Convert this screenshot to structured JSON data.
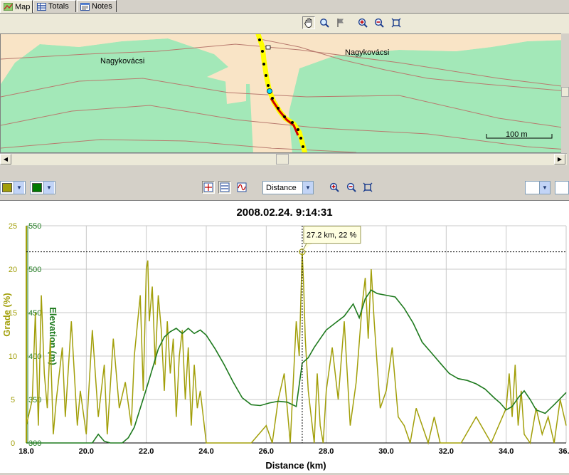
{
  "tabs": [
    {
      "label": "Map",
      "active": true
    },
    {
      "label": "Totals",
      "active": false
    },
    {
      "label": "Notes",
      "active": false
    }
  ],
  "map": {
    "places": [
      {
        "label": "Nagykovácsi",
        "sx": 140,
        "sy": 42
      },
      {
        "label": "Nagykovácsi",
        "sx": 484,
        "sy": 32
      }
    ],
    "scale_label": "100 m",
    "colors": {
      "forest": "#a3e8b8",
      "open": "#f9e4c6",
      "contour": "#b87a6e",
      "track": "#ffff00",
      "track_dots": "#000000",
      "track_red": "#cc0000"
    }
  },
  "chart_toolbar": {
    "color1": "#a29f0a",
    "color2": "#007a00",
    "x_axis_select": "Distance"
  },
  "chart_data": {
    "type": "line",
    "title": "2008.02.24. 9:14:31",
    "xlabel": "Distance (km)",
    "ylabel_left": "Grade (%)",
    "ylabel_right": "Elevation (m)",
    "xlim": [
      18.0,
      36.0
    ],
    "x_ticks": [
      "18.0",
      "20.0",
      "22.0",
      "24.0",
      "26.0",
      "28.0",
      "30.0",
      "32.0",
      "34.0",
      "36.0"
    ],
    "grade_ticks": [
      "0",
      "5",
      "10",
      "15",
      "20",
      "25"
    ],
    "elev_ticks": [
      "300",
      "350",
      "400",
      "450",
      "500",
      "550"
    ],
    "grade_lim": [
      0,
      25
    ],
    "elev_lim": [
      300,
      550
    ],
    "cursor": {
      "x": 27.2,
      "grade": 22,
      "label": "27.2 km, 22 %"
    },
    "grid": true,
    "series": [
      {
        "name": "Elevation (m)",
        "color": "#1e7a1e",
        "x": [
          18.0,
          18.4,
          18.8,
          19.2,
          19.6,
          20.0,
          20.2,
          20.4,
          20.6,
          20.8,
          21.0,
          21.2,
          21.4,
          21.6,
          21.8,
          22.0,
          22.2,
          22.4,
          22.6,
          22.8,
          23.0,
          23.2,
          23.4,
          23.6,
          23.8,
          24.0,
          24.3,
          24.6,
          24.9,
          25.2,
          25.5,
          25.8,
          26.1,
          26.4,
          26.7,
          27.0,
          27.2,
          27.4,
          27.6,
          27.8,
          28.0,
          28.3,
          28.6,
          28.9,
          29.1,
          29.3,
          29.5,
          29.7,
          30.0,
          30.3,
          30.6,
          30.9,
          31.2,
          31.5,
          31.8,
          32.1,
          32.4,
          32.7,
          33.0,
          33.3,
          33.6,
          33.8,
          34.0,
          34.2,
          34.4,
          34.6,
          34.8,
          35.0,
          35.3,
          35.6,
          36.0
        ],
        "values": [
          300,
          300,
          300,
          300,
          300,
          300,
          300,
          310,
          302,
          300,
          300,
          300,
          306,
          318,
          340,
          362,
          385,
          408,
          422,
          428,
          432,
          426,
          432,
          426,
          430,
          424,
          408,
          390,
          370,
          352,
          344,
          343,
          346,
          348,
          347,
          342,
          392,
          398,
          410,
          420,
          430,
          438,
          446,
          460,
          444,
          466,
          476,
          472,
          470,
          468,
          455,
          438,
          416,
          404,
          392,
          380,
          374,
          372,
          368,
          362,
          352,
          346,
          338,
          342,
          352,
          360,
          350,
          338,
          334,
          344,
          358
        ]
      },
      {
        "name": "Grade (%)",
        "color": "#a29f0a",
        "x": [
          18.0,
          18.2,
          18.3,
          18.4,
          18.5,
          18.6,
          18.7,
          18.8,
          18.9,
          19.0,
          19.2,
          19.3,
          19.5,
          19.7,
          19.8,
          20.0,
          20.2,
          20.4,
          20.6,
          20.7,
          20.9,
          21.1,
          21.3,
          21.5,
          21.6,
          21.8,
          21.9,
          22.0,
          22.05,
          22.1,
          22.2,
          22.3,
          22.4,
          22.5,
          22.6,
          22.7,
          22.8,
          22.9,
          23.0,
          23.1,
          23.2,
          23.3,
          23.4,
          23.5,
          23.6,
          23.7,
          23.8,
          23.9,
          24.0,
          24.5,
          25.0,
          25.5,
          26.0,
          26.2,
          26.4,
          26.6,
          26.8,
          27.0,
          27.1,
          27.2,
          27.25,
          27.3,
          27.4,
          27.5,
          27.6,
          27.7,
          27.8,
          27.9,
          28.0,
          28.2,
          28.4,
          28.6,
          28.8,
          29.0,
          29.2,
          29.3,
          29.4,
          29.5,
          29.6,
          29.7,
          29.8,
          30.0,
          30.2,
          30.4,
          30.6,
          30.8,
          31.0,
          31.2,
          31.4,
          31.6,
          31.8,
          32.0,
          32.5,
          33.0,
          33.5,
          34.0,
          34.1,
          34.2,
          34.3,
          34.4,
          34.5,
          34.6,
          34.8,
          35.0,
          35.2,
          35.4,
          35.6,
          35.8,
          36.0
        ],
        "values": [
          2,
          5,
          15,
          2,
          17,
          8,
          4,
          12,
          1,
          5,
          11,
          3,
          14,
          2,
          6,
          1,
          13,
          3,
          9,
          1,
          12,
          4,
          7,
          2,
          10,
          17,
          6,
          20,
          21,
          14,
          18,
          9,
          17,
          13,
          6,
          14,
          8,
          12,
          3,
          10,
          13,
          5,
          11,
          2,
          9,
          4,
          6,
          3,
          0,
          0,
          0,
          0,
          2,
          0,
          5,
          8,
          0,
          14,
          10,
          22,
          18,
          12,
          6,
          3,
          0,
          8,
          2,
          0,
          6,
          11,
          5,
          14,
          2,
          7,
          16,
          19,
          12,
          20,
          14,
          9,
          4,
          6,
          11,
          3,
          2,
          0,
          4,
          2,
          0,
          3,
          0,
          0,
          0,
          3,
          0,
          4,
          8,
          3,
          9,
          2,
          6,
          1,
          0,
          4,
          1,
          3,
          0,
          5,
          2
        ]
      }
    ]
  }
}
